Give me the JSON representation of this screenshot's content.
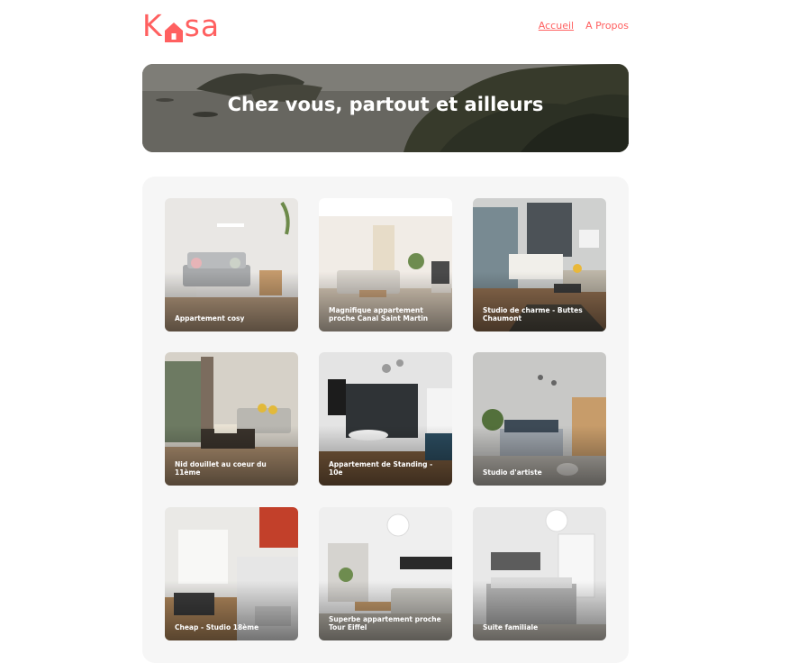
{
  "header": {
    "logo_prefix": "K",
    "logo_suffix": "sa",
    "nav": [
      {
        "label": "Accueil",
        "active": true
      },
      {
        "label": "A Propos",
        "active": false
      }
    ]
  },
  "banner": {
    "title": "Chez vous, partout et ailleurs"
  },
  "gallery": {
    "cards": [
      {
        "title": "Appartement cosy"
      },
      {
        "title": "Magnifique appartement proche Canal Saint Martin"
      },
      {
        "title": "Studio de charme - Buttes Chaumont"
      },
      {
        "title": "Nid douillet au coeur du 11ème"
      },
      {
        "title": "Appartement de Standing - 10e"
      },
      {
        "title": "Studio d'artiste"
      },
      {
        "title": "Cheap - Studio 18ème"
      },
      {
        "title": "Superbe appartement proche Tour Eiffel"
      },
      {
        "title": "Suite familiale"
      }
    ]
  },
  "colors": {
    "brand": "#FF6060",
    "gallery_bg": "#F6F6F6"
  }
}
